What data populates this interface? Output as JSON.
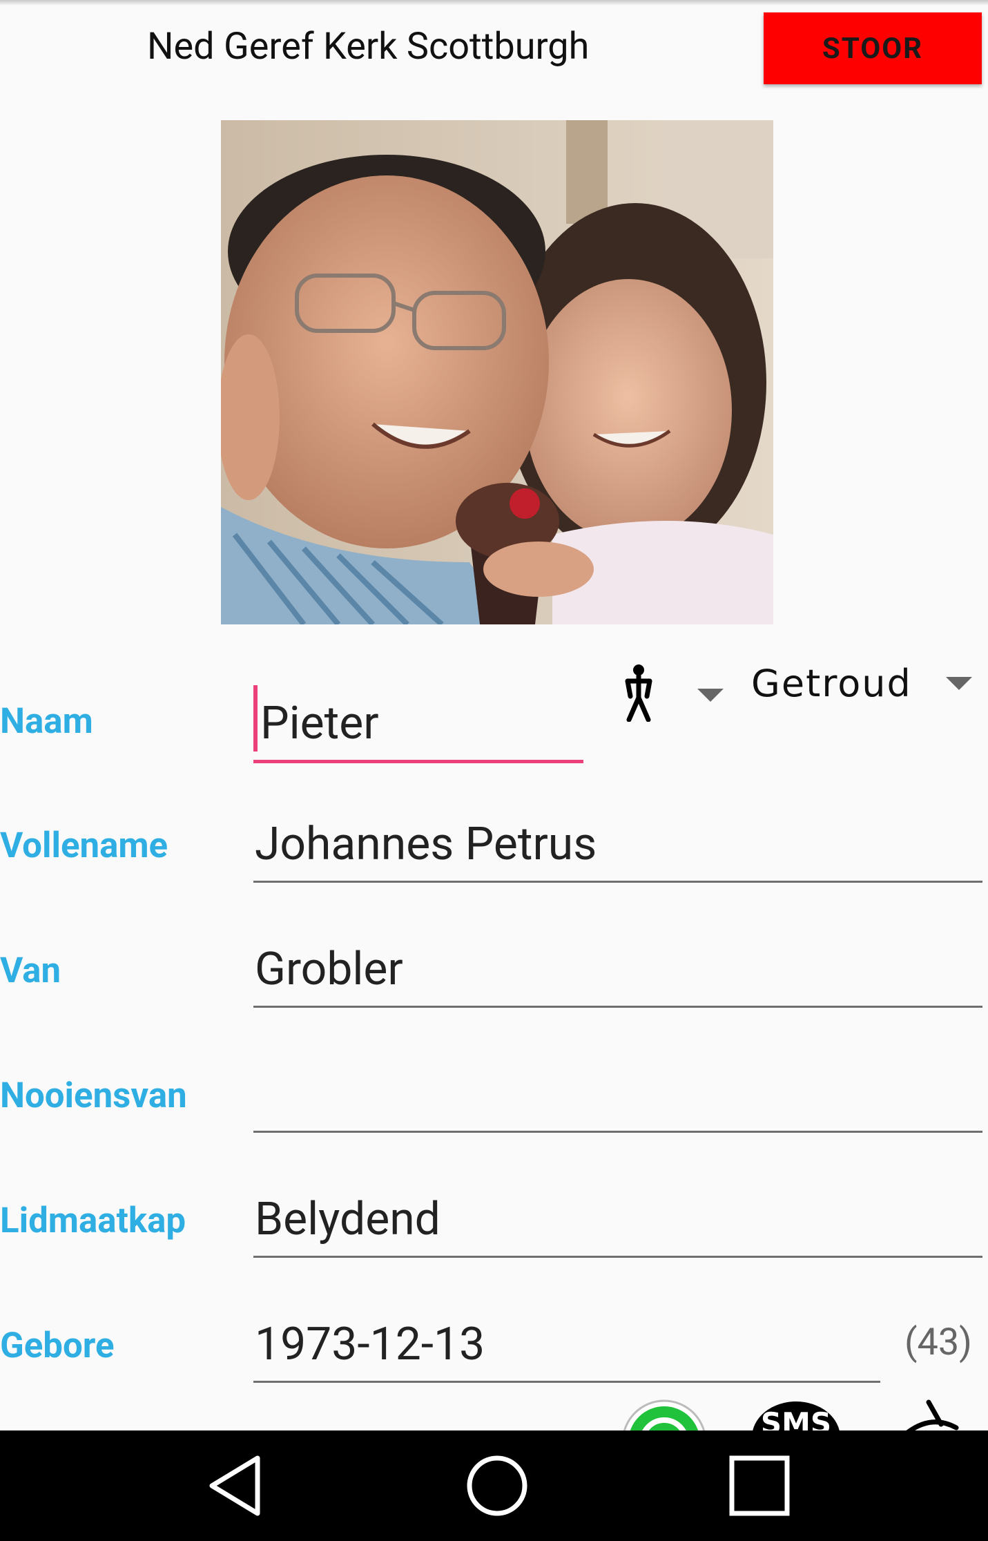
{
  "header": {
    "title": "Ned Geref Kerk Scottburgh",
    "stoor_label": "STOOR"
  },
  "gender_icon": "person-icon",
  "marital_status": "Getroud",
  "fields": {
    "naam": {
      "label": "Naam",
      "value": "Pieter"
    },
    "volleName": {
      "label": "Vollename",
      "value": "Johannes Petrus"
    },
    "van": {
      "label": "Van",
      "value": "Grobler"
    },
    "nooiensvan": {
      "label": "Nooiensvan",
      "value": ""
    },
    "lidmaatskap": {
      "label": "Lidmaatkap",
      "value": "Belydend"
    },
    "gebore": {
      "label": "Gebore",
      "value": "1973-12-13"
    }
  },
  "age": "(43)",
  "contact_icons": [
    "whatsapp-icon",
    "sms-icon",
    "phone-icon"
  ],
  "sms_text": "SMS",
  "navbar": [
    "back-icon",
    "home-icon",
    "recents-icon"
  ],
  "colors": {
    "accent": "#ec407a",
    "label": "#2eaee2",
    "stoor": "#ff0000"
  }
}
